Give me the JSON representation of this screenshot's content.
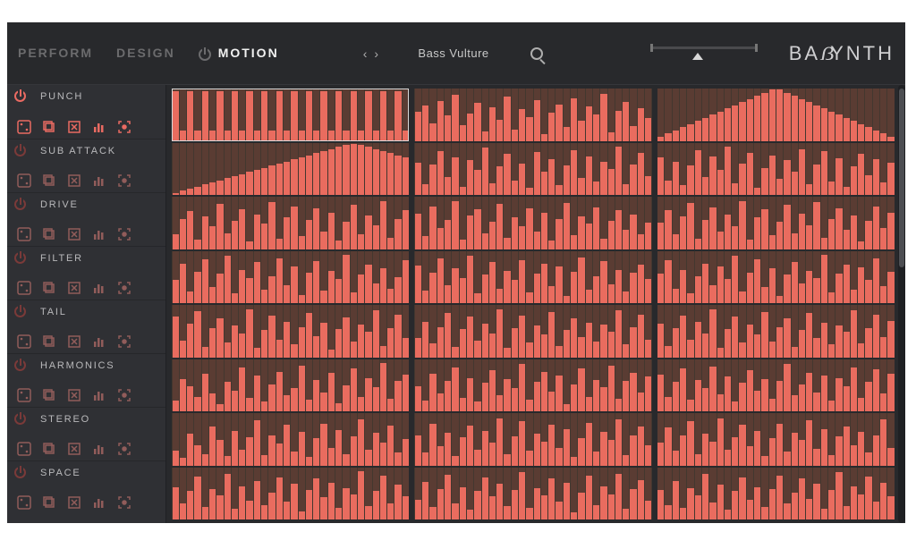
{
  "header": {
    "tabs": [
      "PERFORM",
      "DESIGN",
      "MOTION"
    ],
    "active_tab": "MOTION",
    "preset_name": "Bass Vulture",
    "brand": "BA  YNTH"
  },
  "params": [
    {
      "label": "PUNCH",
      "on": true
    },
    {
      "label": "SUB ATTACK",
      "on": false
    },
    {
      "label": "DRIVE",
      "on": false
    },
    {
      "label": "FILTER",
      "on": false
    },
    {
      "label": "TAIL",
      "on": false
    },
    {
      "label": "HARMONICS",
      "on": false
    },
    {
      "label": "STEREO",
      "on": false
    },
    {
      "label": "SPACE",
      "on": false
    }
  ],
  "tools": [
    "random",
    "copy",
    "clear",
    "bars",
    "target"
  ],
  "sequencer": {
    "rows": 8,
    "blocks_per_row": 3,
    "steps_per_block": 32,
    "patterns": [
      [
        [
          95,
          20,
          95,
          20,
          95,
          20,
          95,
          20,
          95,
          20,
          95,
          20,
          95,
          20,
          95,
          20,
          95,
          20,
          95,
          20,
          95,
          20,
          95,
          20,
          95,
          20,
          95,
          20,
          95,
          20,
          95,
          20
        ],
        [
          55,
          68,
          34,
          76,
          48,
          88,
          30,
          52,
          72,
          18,
          64,
          40,
          84,
          22,
          60,
          46,
          78,
          12,
          54,
          70,
          26,
          82,
          38,
          66,
          50,
          90,
          16,
          58,
          74,
          28,
          62,
          44
        ],
        [
          8,
          14,
          20,
          26,
          32,
          38,
          44,
          50,
          56,
          62,
          68,
          74,
          80,
          86,
          92,
          98,
          98,
          92,
          86,
          80,
          74,
          68,
          62,
          56,
          50,
          44,
          38,
          32,
          26,
          20,
          14,
          8
        ]
      ],
      [
        [
          4,
          8,
          12,
          16,
          20,
          24,
          28,
          32,
          36,
          40,
          44,
          48,
          52,
          56,
          60,
          64,
          68,
          72,
          76,
          80,
          84,
          88,
          92,
          96,
          98,
          96,
          92,
          88,
          84,
          80,
          76,
          72
        ],
        [
          62,
          20,
          58,
          84,
          34,
          72,
          16,
          66,
          48,
          90,
          22,
          54,
          78,
          28,
          60,
          14,
          82,
          44,
          68,
          18,
          56,
          86,
          32,
          74,
          26,
          64,
          50,
          92,
          20,
          58,
          80,
          36
        ],
        [
          72,
          28,
          64,
          18,
          56,
          86,
          34,
          74,
          48,
          92,
          22,
          60,
          80,
          14,
          52,
          76,
          30,
          66,
          44,
          88,
          20,
          58,
          84,
          26,
          70,
          16,
          54,
          78,
          38,
          68,
          24,
          62
        ]
      ],
      [
        [
          28,
          58,
          72,
          18,
          62,
          44,
          86,
          30,
          54,
          76,
          14,
          66,
          48,
          90,
          20,
          60,
          82,
          24,
          56,
          78,
          34,
          70,
          16,
          52,
          84,
          28,
          64,
          46,
          92,
          22,
          58,
          74
        ],
        [
          68,
          24,
          82,
          40,
          56,
          92,
          18,
          64,
          76,
          30,
          52,
          86,
          22,
          60,
          44,
          78,
          34,
          70,
          16,
          58,
          88,
          26,
          62,
          48,
          80,
          20,
          54,
          74,
          36,
          66,
          28,
          50
        ],
        [
          50,
          74,
          28,
          62,
          88,
          20,
          56,
          80,
          34,
          66,
          44,
          92,
          18,
          60,
          76,
          26,
          52,
          84,
          30,
          68,
          46,
          90,
          22,
          58,
          78,
          36,
          64,
          14,
          54,
          82,
          40,
          70
        ]
      ],
      [
        [
          44,
          76,
          22,
          60,
          84,
          30,
          56,
          90,
          18,
          64,
          48,
          78,
          26,
          52,
          86,
          34,
          70,
          16,
          58,
          80,
          24,
          62,
          46,
          92,
          20,
          54,
          74,
          38,
          66,
          28,
          50,
          82
        ],
        [
          72,
          24,
          58,
          86,
          34,
          66,
          48,
          90,
          18,
          54,
          78,
          28,
          62,
          44,
          82,
          20,
          56,
          76,
          32,
          70,
          14,
          60,
          88,
          26,
          52,
          80,
          36,
          64,
          22,
          58,
          74,
          46
        ],
        [
          56,
          82,
          28,
          64,
          18,
          52,
          76,
          34,
          70,
          46,
          90,
          22,
          58,
          84,
          30,
          66,
          14,
          54,
          78,
          38,
          62,
          48,
          92,
          20,
          56,
          74,
          26,
          68,
          44,
          86,
          32,
          60
        ]
      ],
      [
        [
          78,
          32,
          64,
          88,
          20,
          56,
          74,
          28,
          60,
          46,
          92,
          18,
          52,
          80,
          34,
          68,
          24,
          58,
          84,
          40,
          66,
          14,
          54,
          76,
          30,
          62,
          48,
          90,
          22,
          56,
          82,
          36
        ],
        [
          36,
          68,
          26,
          58,
          84,
          20,
          54,
          78,
          32,
          64,
          46,
          92,
          18,
          56,
          80,
          28,
          60,
          44,
          86,
          22,
          52,
          74,
          38,
          66,
          30,
          62,
          48,
          90,
          24,
          58,
          82,
          34
        ],
        [
          64,
          22,
          56,
          80,
          34,
          68,
          46,
          92,
          18,
          54,
          78,
          28,
          62,
          44,
          86,
          30,
          58,
          74,
          20,
          52,
          84,
          36,
          66,
          24,
          60,
          48,
          90,
          26,
          56,
          82,
          38,
          70
        ]
      ],
      [
        [
          20,
          62,
          48,
          28,
          72,
          34,
          14,
          56,
          40,
          84,
          26,
          68,
          18,
          52,
          76,
          30,
          44,
          88,
          22,
          60,
          36,
          74,
          16,
          50,
          82,
          28,
          64,
          46,
          92,
          24,
          58,
          70
        ],
        [
          48,
          20,
          72,
          34,
          58,
          84,
          26,
          64,
          18,
          54,
          78,
          30,
          62,
          44,
          90,
          22,
          56,
          76,
          38,
          68,
          14,
          52,
          82,
          28,
          60,
          46,
          88,
          24,
          58,
          74,
          36,
          66
        ],
        [
          70,
          28,
          56,
          82,
          22,
          60,
          44,
          86,
          32,
          66,
          18,
          54,
          78,
          40,
          62,
          24,
          58,
          90,
          30,
          52,
          74,
          36,
          68,
          20,
          64,
          48,
          84,
          26,
          56,
          80,
          34,
          72
        ]
      ],
      [
        [
          28,
          14,
          60,
          38,
          22,
          74,
          48,
          18,
          66,
          30,
          54,
          86,
          20,
          58,
          42,
          78,
          26,
          64,
          16,
          52,
          80,
          34,
          68,
          22,
          56,
          88,
          30,
          62,
          44,
          76,
          24,
          50
        ],
        [
          58,
          24,
          80,
          36,
          62,
          18,
          54,
          76,
          30,
          66,
          44,
          90,
          22,
          56,
          84,
          28,
          60,
          46,
          78,
          34,
          70,
          16,
          52,
          82,
          26,
          64,
          48,
          88,
          20,
          58,
          74,
          38
        ],
        [
          44,
          72,
          28,
          58,
          84,
          22,
          60,
          46,
          90,
          30,
          54,
          78,
          36,
          66,
          18,
          52,
          80,
          26,
          62,
          48,
          86,
          32,
          70,
          20,
          56,
          74,
          38,
          64,
          24,
          58,
          88,
          34
        ]
      ],
      [
        [
          62,
          30,
          54,
          82,
          24,
          58,
          46,
          88,
          20,
          64,
          36,
          74,
          28,
          52,
          80,
          34,
          68,
          16,
          56,
          78,
          42,
          70,
          22,
          60,
          48,
          92,
          26,
          54,
          84,
          30,
          66,
          44
        ],
        [
          38,
          72,
          24,
          58,
          86,
          30,
          62,
          18,
          54,
          80,
          44,
          68,
          26,
          56,
          90,
          22,
          60,
          46,
          78,
          34,
          70,
          14,
          52,
          84,
          28,
          64,
          48,
          88,
          20,
          58,
          76,
          36
        ],
        [
          56,
          28,
          74,
          22,
          60,
          46,
          88,
          32,
          66,
          18,
          54,
          80,
          38,
          62,
          24,
          58,
          84,
          30,
          52,
          78,
          40,
          68,
          20,
          56,
          90,
          26,
          64,
          48,
          82,
          34,
          70,
          44
        ]
      ]
    ]
  }
}
